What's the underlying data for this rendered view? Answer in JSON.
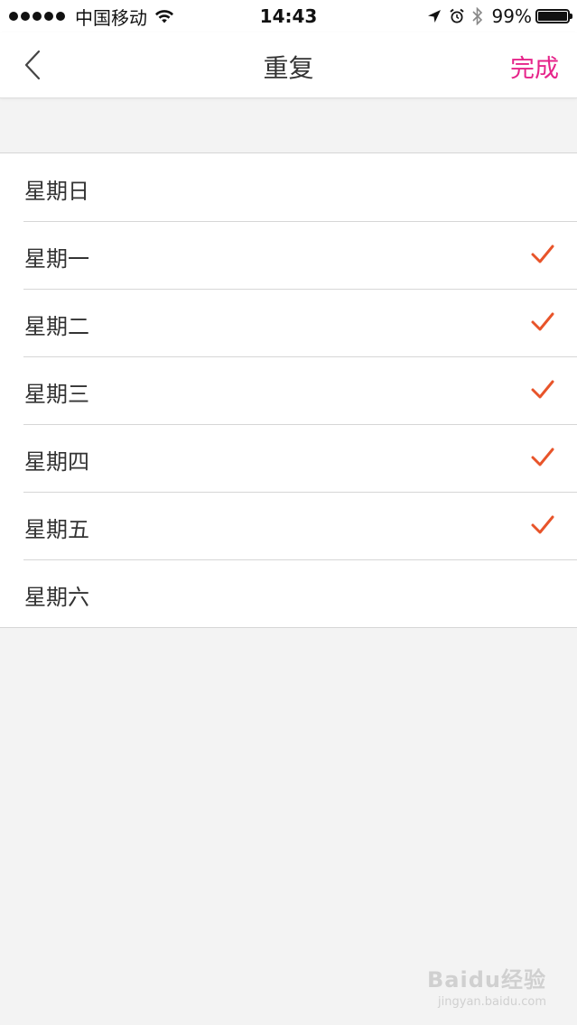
{
  "status_bar": {
    "carrier": "中国移动",
    "time": "14:43",
    "battery_percent": "99%",
    "battery_level": 0.99,
    "icons": [
      "signal-dots",
      "wifi-icon",
      "location-arrow-icon",
      "alarm-icon",
      "bluetooth-icon",
      "battery-icon"
    ]
  },
  "nav": {
    "back_icon": "chevron-left-icon",
    "title": "重复",
    "done_label": "完成",
    "done_color": "#e6248a"
  },
  "days": [
    {
      "label": "星期日",
      "checked": false
    },
    {
      "label": "星期一",
      "checked": true
    },
    {
      "label": "星期二",
      "checked": true
    },
    {
      "label": "星期三",
      "checked": true
    },
    {
      "label": "星期四",
      "checked": true
    },
    {
      "label": "星期五",
      "checked": true
    },
    {
      "label": "星期六",
      "checked": false
    }
  ],
  "check_color": "#e8542a",
  "watermark": {
    "main": "Baidu经验",
    "sub": "jingyan.baidu.com"
  }
}
